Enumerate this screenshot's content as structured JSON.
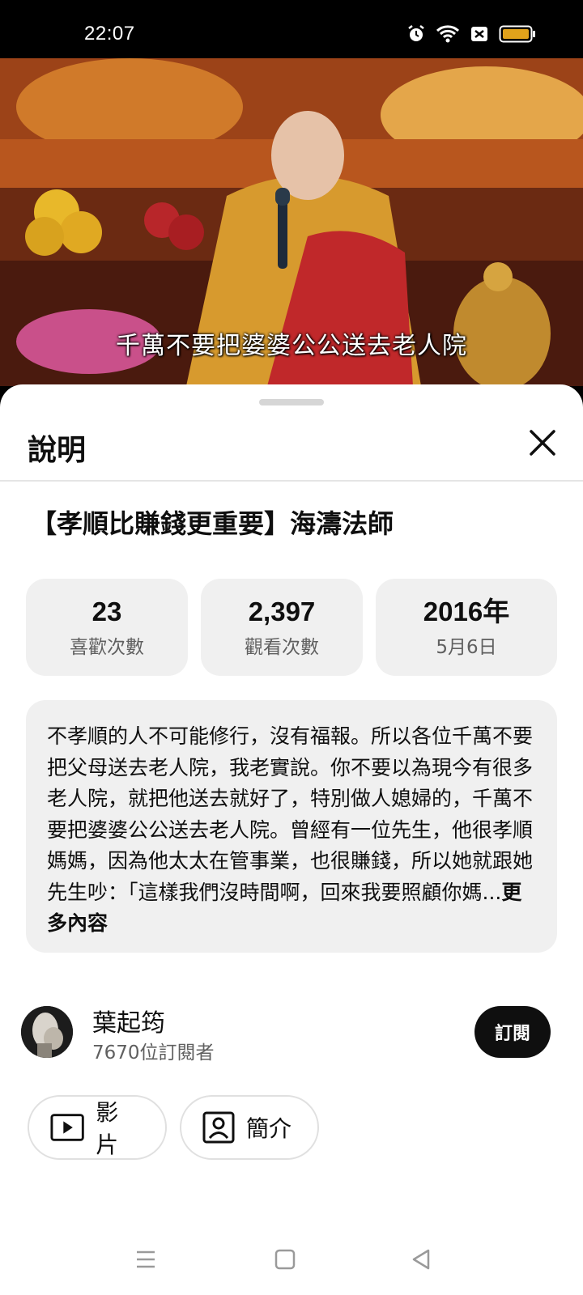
{
  "status_bar": {
    "time": "22:07",
    "icons": [
      "alarm-icon",
      "wifi-icon",
      "sim-off-icon",
      "battery-icon"
    ]
  },
  "video": {
    "subtitle": "千萬不要把婆婆公公送去老人院"
  },
  "sheet": {
    "header_title": "說明",
    "video_title": "【孝順比賺錢更重要】海濤法師",
    "stats": [
      {
        "value": "23",
        "label": "喜歡次數"
      },
      {
        "value": "2,397",
        "label": "觀看次數"
      },
      {
        "value": "2016年",
        "label": "5月6日"
      }
    ],
    "description": "不孝順的人不可能修行，沒有福報。所以各位千萬不要把父母送去老人院，我老實說。你不要以為現今有很多老人院，就把他送去就好了，特別做人媳婦的，千萬不要把婆婆公公送去老人院。曾經有一位先生，他很孝順媽媽，因為他太太在管事業，也很賺錢，所以她就跟她先生吵：「這樣我們沒時間啊，回來我要照顧你媽...",
    "more_label": "更多內容"
  },
  "channel": {
    "name": "葉起筠",
    "subscribers": "7670位訂閱者",
    "subscribe_label": "訂閱"
  },
  "chips": {
    "videos_label": "影片",
    "about_label": "簡介"
  },
  "colors": {
    "sheet_bg": "#ffffff",
    "card_bg": "#f0f0f0",
    "subscribe_bg": "#0f0f0f",
    "secondary_text": "#606060",
    "battery": "#e0a21b"
  }
}
